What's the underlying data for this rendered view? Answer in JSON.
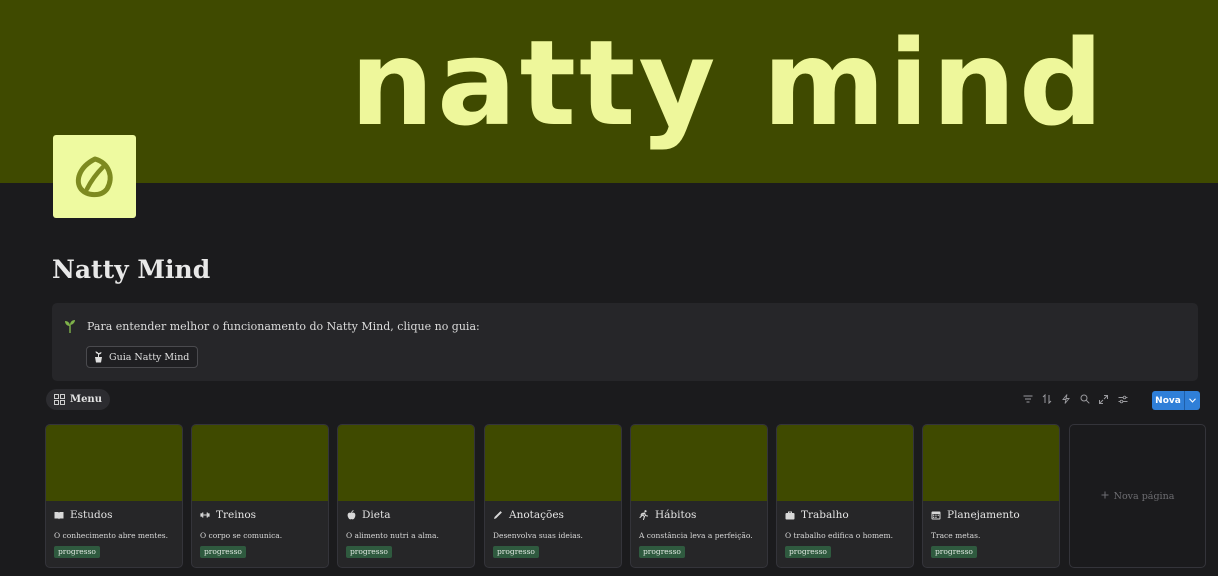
{
  "cover": {
    "text": "natty mind",
    "color": "#3f4a00",
    "text_color": "#eef79b"
  },
  "page": {
    "icon": "leaf-icon",
    "title": "Natty Mind"
  },
  "callout": {
    "icon": "sprout-icon",
    "text": "Para entender melhor o funcionamento do Natty Mind, clique no guia:",
    "button_label": "Guia Natty Mind",
    "button_icon": "plant-pot-icon"
  },
  "view": {
    "tab_label": "Menu",
    "tab_icon": "gallery-grid-icon"
  },
  "toolbar": {
    "icons": [
      "filter-icon",
      "sort-icon",
      "automation-icon",
      "search-icon",
      "expand-icon",
      "settings-icon"
    ],
    "new_label": "Nova",
    "accent": "#2f7fd8"
  },
  "cards": [
    {
      "title": "Estudos",
      "icon": "book-icon",
      "description": "O conhecimento abre mentes.",
      "tag": "progresso"
    },
    {
      "title": "Treinos",
      "icon": "dumbbell-icon",
      "description": "O corpo se comunica.",
      "tag": "progresso"
    },
    {
      "title": "Dieta",
      "icon": "apple-icon",
      "description": "O alimento nutri a alma.",
      "tag": "progresso"
    },
    {
      "title": "Anotações",
      "icon": "pencil-icon",
      "description": "Desenvolva suas ideias.",
      "tag": "progresso"
    },
    {
      "title": "Hábitos",
      "icon": "runner-icon",
      "description": "A constância leva a perfeição.",
      "tag": "progresso"
    },
    {
      "title": "Trabalho",
      "icon": "briefcase-icon",
      "description": "O trabalho edifica o homem.",
      "tag": "progresso"
    },
    {
      "title": "Planejamento",
      "icon": "calendar-icon",
      "description": "Trace metas.",
      "tag": "progresso"
    }
  ],
  "new_page_label": "Nova página"
}
